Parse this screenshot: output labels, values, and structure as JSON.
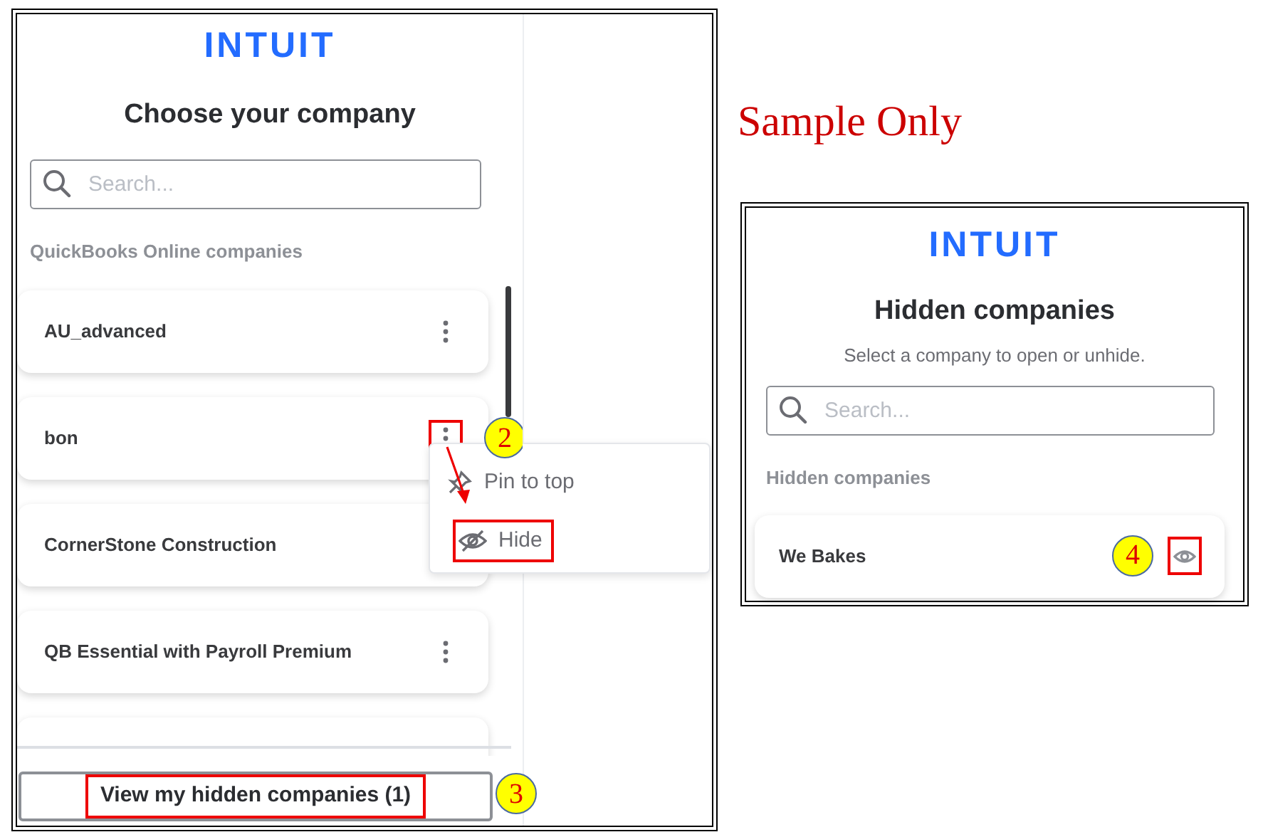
{
  "annotation": {
    "text": "Sample Only"
  },
  "company_chooser": {
    "logo": "INTUIT",
    "title": "Choose your company",
    "search": {
      "placeholder": "Search..."
    },
    "section_label": "QuickBooks Online companies",
    "companies": [
      {
        "name": "AU_advanced",
        "kebab": true,
        "highlighted": false
      },
      {
        "name": "bon",
        "kebab": true,
        "highlighted": true,
        "step": "2"
      },
      {
        "name": "CornerStone Construction",
        "kebab": false,
        "highlighted": false
      },
      {
        "name": "QB Essential with Payroll Premium",
        "kebab": true,
        "highlighted": false
      },
      {
        "kebab": false,
        "highlighted": false
      }
    ],
    "menu": {
      "items": [
        {
          "label": "Pin to top",
          "highlighted": false
        },
        {
          "label": "Hide",
          "highlighted": true
        }
      ]
    },
    "hidden_button": {
      "label": "View my hidden companies (1)",
      "highlighted": true,
      "step": "3"
    }
  },
  "hidden_companies": {
    "logo": "INTUIT",
    "title": "Hidden companies",
    "subtitle": "Select a company to open or unhide.",
    "search": {
      "placeholder": "Search..."
    },
    "section_label": "Hidden companies",
    "companies": [
      {
        "name": "We Bakes",
        "highlighted": true,
        "step": "4"
      }
    ]
  }
}
